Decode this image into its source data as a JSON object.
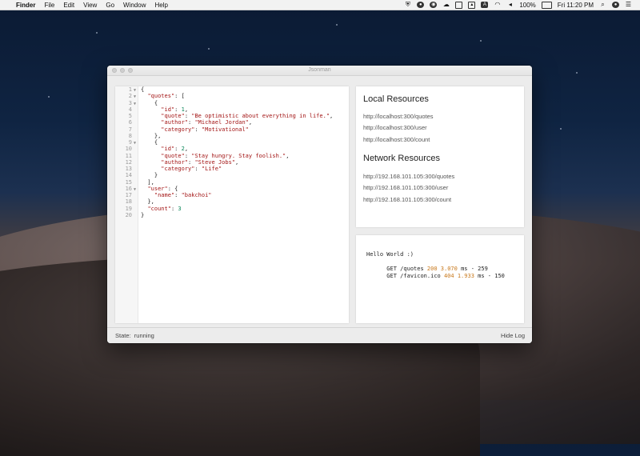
{
  "menubar": {
    "app_name": "Finder",
    "items": [
      "File",
      "Edit",
      "View",
      "Go",
      "Window",
      "Help"
    ],
    "battery": "100%",
    "clock": "Fri 11:20 PM"
  },
  "window": {
    "title": "Jsonman"
  },
  "editor": {
    "lines": [
      {
        "num": "1",
        "fold": true
      },
      {
        "num": "2",
        "fold": true
      },
      {
        "num": "3",
        "fold": true
      },
      {
        "num": "4",
        "fold": false
      },
      {
        "num": "5",
        "fold": false
      },
      {
        "num": "6",
        "fold": false
      },
      {
        "num": "7",
        "fold": false
      },
      {
        "num": "8",
        "fold": false
      },
      {
        "num": "9",
        "fold": true
      },
      {
        "num": "10",
        "fold": false
      },
      {
        "num": "11",
        "fold": false
      },
      {
        "num": "12",
        "fold": false
      },
      {
        "num": "13",
        "fold": false
      },
      {
        "num": "14",
        "fold": false
      },
      {
        "num": "15",
        "fold": false
      },
      {
        "num": "16",
        "fold": true
      },
      {
        "num": "17",
        "fold": false
      },
      {
        "num": "18",
        "fold": false
      },
      {
        "num": "19",
        "fold": false
      },
      {
        "num": "20",
        "fold": false
      }
    ],
    "code": [
      [
        {
          "t": "p",
          "v": "{"
        }
      ],
      [
        {
          "t": "p",
          "v": "  "
        },
        {
          "t": "k",
          "v": "\"quotes\""
        },
        {
          "t": "p",
          "v": ": ["
        }
      ],
      [
        {
          "t": "p",
          "v": "    {"
        }
      ],
      [
        {
          "t": "p",
          "v": "      "
        },
        {
          "t": "k",
          "v": "\"id\""
        },
        {
          "t": "p",
          "v": ": "
        },
        {
          "t": "n",
          "v": "1"
        },
        {
          "t": "p",
          "v": ","
        }
      ],
      [
        {
          "t": "p",
          "v": "      "
        },
        {
          "t": "k",
          "v": "\"quote\""
        },
        {
          "t": "p",
          "v": ": "
        },
        {
          "t": "s",
          "v": "\"Be optimistic about everything in life.\""
        },
        {
          "t": "p",
          "v": ","
        }
      ],
      [
        {
          "t": "p",
          "v": "      "
        },
        {
          "t": "k",
          "v": "\"author\""
        },
        {
          "t": "p",
          "v": ": "
        },
        {
          "t": "s",
          "v": "\"Michael Jordan\""
        },
        {
          "t": "p",
          "v": ","
        }
      ],
      [
        {
          "t": "p",
          "v": "      "
        },
        {
          "t": "k",
          "v": "\"category\""
        },
        {
          "t": "p",
          "v": ": "
        },
        {
          "t": "s",
          "v": "\"Motivational\""
        }
      ],
      [
        {
          "t": "p",
          "v": "    },"
        }
      ],
      [
        {
          "t": "p",
          "v": "    {"
        }
      ],
      [
        {
          "t": "p",
          "v": "      "
        },
        {
          "t": "k",
          "v": "\"id\""
        },
        {
          "t": "p",
          "v": ": "
        },
        {
          "t": "n",
          "v": "2"
        },
        {
          "t": "p",
          "v": ","
        }
      ],
      [
        {
          "t": "p",
          "v": "      "
        },
        {
          "t": "k",
          "v": "\"quote\""
        },
        {
          "t": "p",
          "v": ": "
        },
        {
          "t": "s",
          "v": "\"Stay hungry. Stay foolish.\""
        },
        {
          "t": "p",
          "v": ","
        }
      ],
      [
        {
          "t": "p",
          "v": "      "
        },
        {
          "t": "k",
          "v": "\"author\""
        },
        {
          "t": "p",
          "v": ": "
        },
        {
          "t": "s",
          "v": "\"Steve Jobs\""
        },
        {
          "t": "p",
          "v": ","
        }
      ],
      [
        {
          "t": "p",
          "v": "      "
        },
        {
          "t": "k",
          "v": "\"category\""
        },
        {
          "t": "p",
          "v": ": "
        },
        {
          "t": "s",
          "v": "\"Life\""
        }
      ],
      [
        {
          "t": "p",
          "v": "    }"
        }
      ],
      [
        {
          "t": "p",
          "v": "  ],"
        }
      ],
      [
        {
          "t": "p",
          "v": "  "
        },
        {
          "t": "k",
          "v": "\"user\""
        },
        {
          "t": "p",
          "v": ": {"
        }
      ],
      [
        {
          "t": "p",
          "v": "    "
        },
        {
          "t": "k",
          "v": "\"name\""
        },
        {
          "t": "p",
          "v": ": "
        },
        {
          "t": "s",
          "v": "\"bakchoi\""
        }
      ],
      [
        {
          "t": "p",
          "v": "  },"
        }
      ],
      [
        {
          "t": "p",
          "v": "  "
        },
        {
          "t": "k",
          "v": "\"count\""
        },
        {
          "t": "p",
          "v": ": "
        },
        {
          "t": "n",
          "v": "3"
        }
      ],
      [
        {
          "t": "p",
          "v": "}"
        }
      ]
    ]
  },
  "resources": {
    "local_heading": "Local Resources",
    "local_links": [
      "http://localhost:300/quotes",
      "http://localhost:300/user",
      "http://localhost:300/count"
    ],
    "network_heading": "Network Resources",
    "network_links": [
      "http://192.168.101.105:300/quotes",
      "http://192.168.101.105:300/user",
      "http://192.168.101.105:300/count"
    ]
  },
  "log": {
    "greeting": "Hello World :)",
    "requests": [
      {
        "method": "GET",
        "path": "/quotes",
        "status": "200",
        "time": "3.070",
        "unit": "ms",
        "size": "259"
      },
      {
        "method": "GET",
        "path": "/favicon.ico",
        "status": "404",
        "time": "1.933",
        "unit": "ms",
        "size": "150"
      }
    ]
  },
  "statusbar": {
    "state_label": "State:",
    "state_value": "running",
    "hide_log": "Hide Log"
  },
  "colors": {
    "json_key": "#a31515",
    "json_number": "#098658",
    "log_highlight": "#c8781b"
  }
}
